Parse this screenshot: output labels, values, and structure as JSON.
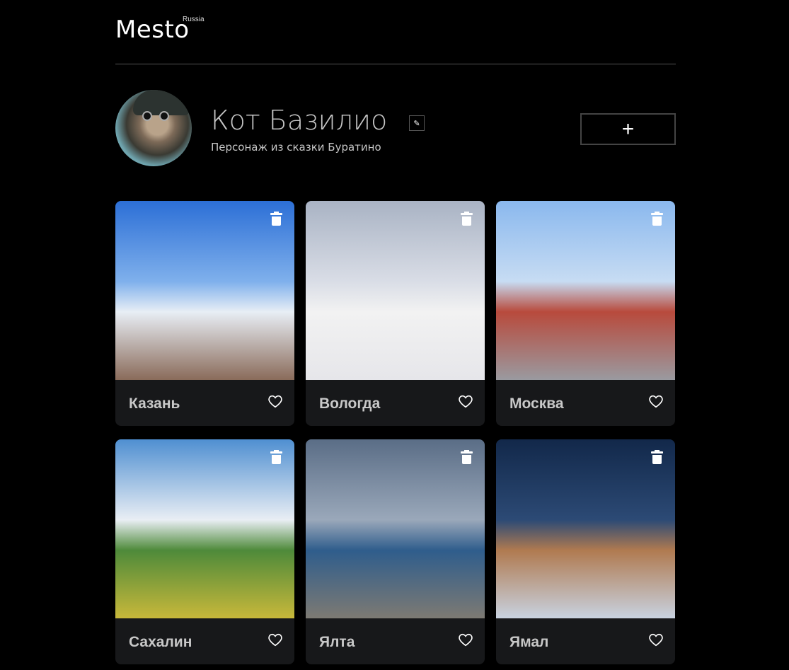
{
  "header": {
    "logo": "Mesto",
    "logo_sub": "Russia"
  },
  "profile": {
    "name": "Кот Базилио",
    "about": "Персонаж из сказки Буратино",
    "edit_icon": "pencil-icon",
    "add_icon": "plus-icon",
    "add_label": "+"
  },
  "cards": [
    {
      "title": "Казань",
      "colors": [
        "#2c6fd6",
        "#7fb0ec",
        "#e8eef5",
        "#8a6b5a"
      ]
    },
    {
      "title": "Вологда",
      "colors": [
        "#a9b3c4",
        "#d9dde6",
        "#f2f2f2",
        "#e6e6ea"
      ]
    },
    {
      "title": "Москва",
      "colors": [
        "#8ab8ee",
        "#c7dcf3",
        "#b84a3c",
        "#9a9aa0"
      ]
    },
    {
      "title": "Сахалин",
      "colors": [
        "#4f8fd1",
        "#e9eef4",
        "#4e8a3a",
        "#c8b83a"
      ]
    },
    {
      "title": "Ялта",
      "colors": [
        "#5a6d86",
        "#9aa8ba",
        "#2f5d8c",
        "#7d7a73"
      ]
    },
    {
      "title": "Ямал",
      "colors": [
        "#12284a",
        "#2c4a75",
        "#b07a50",
        "#c8d2e0"
      ]
    }
  ]
}
